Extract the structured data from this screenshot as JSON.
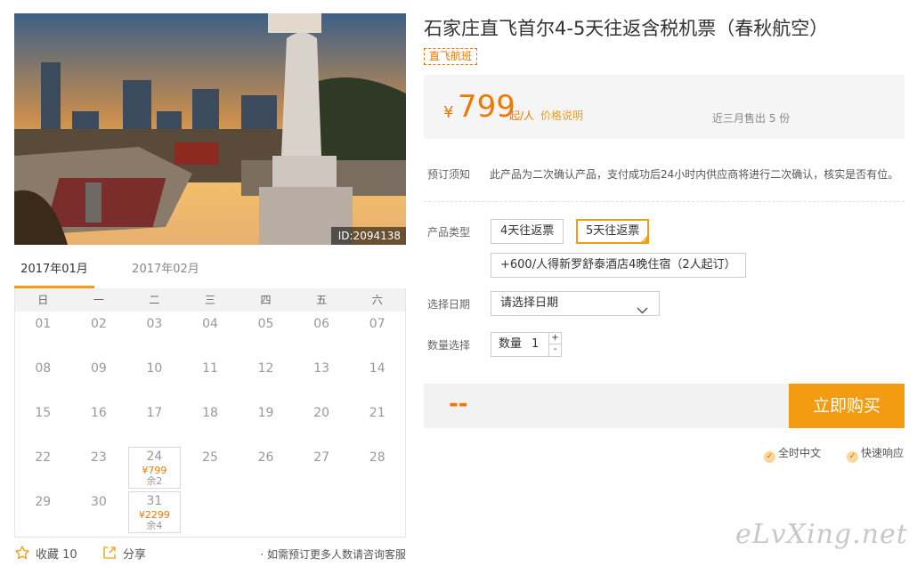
{
  "product": {
    "title": "石家庄直飞首尔4-5天往返含税机票（春秋航空）",
    "tag": "直飞航班",
    "image_id": "ID:2094138"
  },
  "price": {
    "currency": "¥",
    "amount": "799",
    "unit": "起/人",
    "note_link": "价格说明",
    "sold": "近三月售出 5 份"
  },
  "booking": {
    "notice_label": "预订须知",
    "notice_text": "此产品为二次确认产品，支付成功后24小时内供应商将进行二次确认，核实是否有位。",
    "type_label": "产品类型",
    "types": [
      "4天往返票",
      "5天往返票"
    ],
    "selected_type": "5天往返票",
    "addon": "+600/人得新罗舒泰酒店4晚住宿（2人起订）",
    "date_label": "选择日期",
    "date_placeholder": "请选择日期",
    "qty_label": "数量选择",
    "qty_inner_label": "数量",
    "qty_value": "1",
    "plus": "+",
    "minus": "-"
  },
  "buy": {
    "total": "--",
    "button": "立即购买"
  },
  "guarantees": [
    "全时中文",
    "快速响应"
  ],
  "calendar": {
    "months": [
      "2017年01月",
      "2017年02月"
    ],
    "active_month": "2017年01月",
    "weekdays": [
      "日",
      "一",
      "二",
      "三",
      "四",
      "五",
      "六"
    ],
    "days": [
      {
        "d": "01"
      },
      {
        "d": "02"
      },
      {
        "d": "03"
      },
      {
        "d": "04"
      },
      {
        "d": "05"
      },
      {
        "d": "06"
      },
      {
        "d": "07"
      },
      {
        "d": "08"
      },
      {
        "d": "09"
      },
      {
        "d": "10"
      },
      {
        "d": "11"
      },
      {
        "d": "12"
      },
      {
        "d": "13"
      },
      {
        "d": "14"
      },
      {
        "d": "15"
      },
      {
        "d": "16"
      },
      {
        "d": "17"
      },
      {
        "d": "18"
      },
      {
        "d": "19"
      },
      {
        "d": "20"
      },
      {
        "d": "21"
      },
      {
        "d": "22"
      },
      {
        "d": "23"
      },
      {
        "d": "24",
        "price": "¥799",
        "stock": "余2"
      },
      {
        "d": "25"
      },
      {
        "d": "26"
      },
      {
        "d": "27"
      },
      {
        "d": "28"
      },
      {
        "d": "29"
      },
      {
        "d": "30"
      },
      {
        "d": "31",
        "price": "¥2299",
        "stock": "余4"
      }
    ]
  },
  "footer": {
    "favorite": "收藏 10",
    "share": "分享",
    "consult": "· 如需预订更多人数请咨询客服"
  },
  "watermark": "eLvXing.net",
  "colors": {
    "accent": "#f39c12",
    "price": "#f07800"
  }
}
